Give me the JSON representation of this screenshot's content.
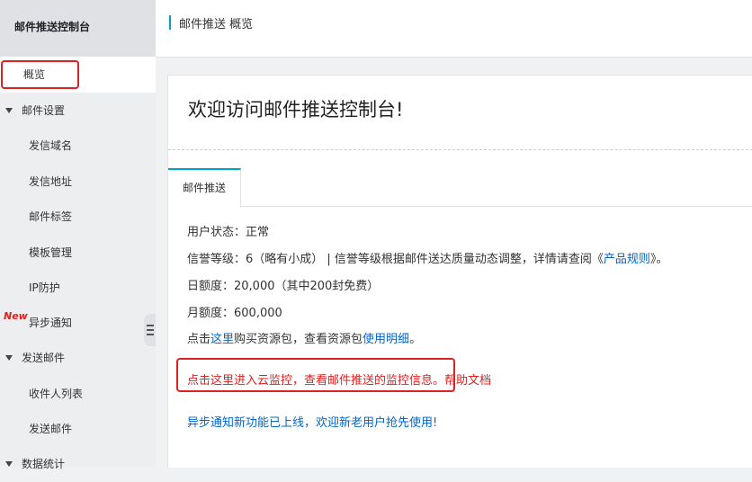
{
  "sidebar": {
    "title": "邮件推送控制台",
    "items": [
      {
        "label": "概览"
      },
      {
        "label": "邮件设置"
      },
      {
        "label": "发信域名"
      },
      {
        "label": "发信地址"
      },
      {
        "label": "邮件标签"
      },
      {
        "label": "模板管理"
      },
      {
        "label": "IP防护"
      },
      {
        "label": "异步通知",
        "badge": "New"
      },
      {
        "label": "发送邮件"
      },
      {
        "label": "收件人列表"
      },
      {
        "label": "发送邮件"
      },
      {
        "label": "数据统计"
      }
    ]
  },
  "header": {
    "breadcrumb": "邮件推送 概览"
  },
  "main": {
    "welcome": "欢迎访问邮件推送控制台!",
    "tab": "邮件推送",
    "user_status": "用户状态：正常",
    "reputation_prefix": "信誉等级：6（略有小成） | 信誉等级根据邮件送达质量动态调整，详情请查阅《",
    "reputation_link": "产品规则",
    "reputation_suffix": "》。",
    "daily_quota": "日额度：20,000（其中200封免费）",
    "monthly_quota": "月额度：600,000",
    "buy_prefix": "点击",
    "buy_link": "这里",
    "buy_middle": "购买资源包，查看资源包",
    "buy_link2": "使用明细",
    "buy_suffix": "。",
    "monitor_text": "点击这里进入云监控，查看邮件推送的监控信息。",
    "help_link": "帮助文档",
    "announcement": "异步通知新功能已上线，欢迎新老用户抢先使用!"
  },
  "colors": {
    "accent": "#00a2ca",
    "link": "#0066cc",
    "highlight": "#e02020"
  }
}
